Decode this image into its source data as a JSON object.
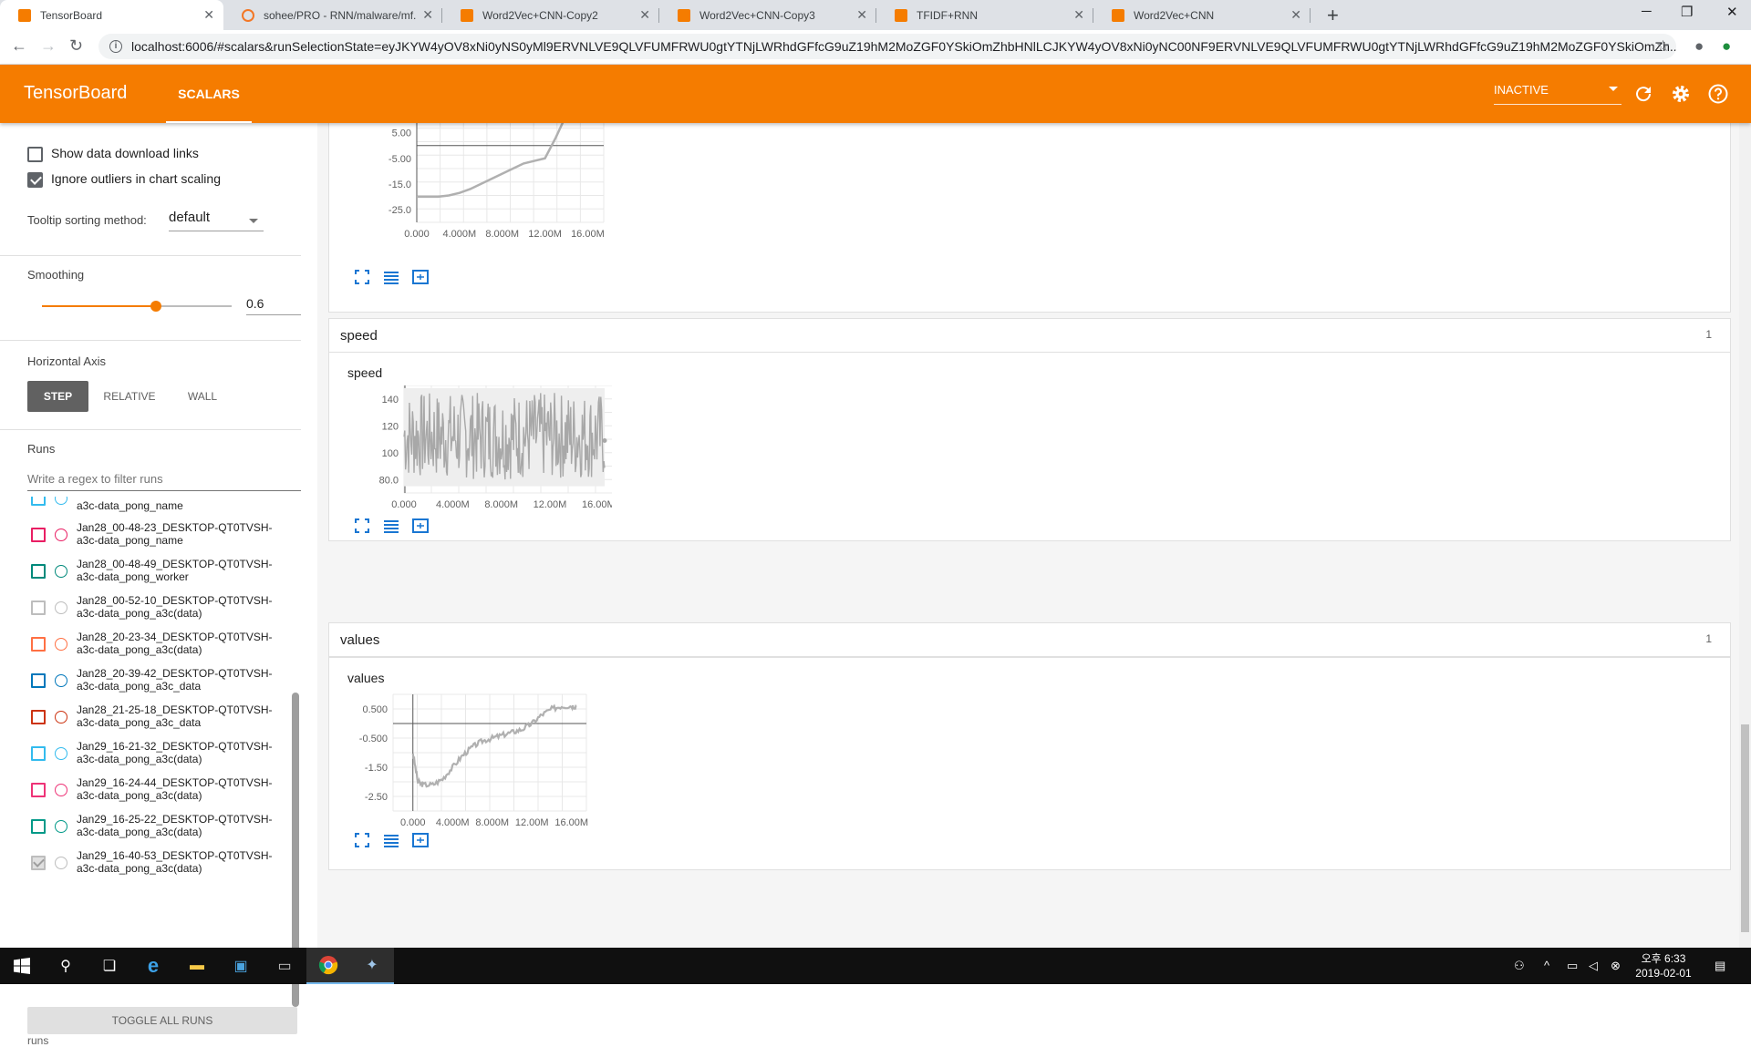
{
  "browser": {
    "tabs": [
      {
        "title": "TensorBoard",
        "favicon": "tensorboard-icon"
      },
      {
        "title": "sohee/PRO - RNN/malware/mf...",
        "favicon": "jupyter-icon"
      },
      {
        "title": "Word2Vec+CNN-Copy2",
        "favicon": "tensorboard-icon"
      },
      {
        "title": "Word2Vec+CNN-Copy3",
        "favicon": "tensorboard-icon"
      },
      {
        "title": "TFIDF+RNN",
        "favicon": "tensorboard-icon"
      },
      {
        "title": "Word2Vec+CNN",
        "favicon": "tensorboard-icon"
      }
    ],
    "url": "localhost:6006/#scalars&runSelectionState=eyJKYW4yOV8xNi0yNS0yMl9ERVNLVE9QLVFUMFRWU0gtYTNjLWRhdGFfcG9uZ19hM2MoZGF0YSkiOmZhbHNlLCJKYW4yOV8xNi0yNC00NF9ERVNLVE9QLVFUMFRWU0gtYTNjLWRhdGFfcG9uZ19hM2MoZGF0YSkiOmZh..."
  },
  "header": {
    "brand": "TensorBoard",
    "tab": "SCALARS",
    "mode": "INACTIVE",
    "colors": {
      "accent": "#f57c00"
    }
  },
  "sidebar": {
    "show_download_links": "Show data download links",
    "ignore_outliers": "Ignore outliers in chart scaling",
    "tooltip_label": "Tooltip sorting method:",
    "tooltip_value": "default",
    "smoothing_label": "Smoothing",
    "smoothing_value": "0.6",
    "smoothing": 0.6,
    "axis_label": "Horizontal Axis",
    "axis_options": [
      "STEP",
      "RELATIVE",
      "WALL"
    ],
    "runs_label": "Runs",
    "regex_placeholder": "Write a regex to filter runs",
    "partial_run": "a3c-data_pong_name",
    "runs": [
      {
        "line1": "Jan28_00-48-23_DESKTOP-QT0TVSH-",
        "line2": "a3c-data_pong_name",
        "color": "#e91e63",
        "checked": false,
        "enabled": true
      },
      {
        "line1": "Jan28_00-48-49_DESKTOP-QT0TVSH-",
        "line2": "a3c-data_pong_worker",
        "color": "#00897b",
        "checked": false,
        "enabled": true
      },
      {
        "line1": "Jan28_00-52-10_DESKTOP-QT0TVSH-",
        "line2": "a3c-data_pong_a3c(data)",
        "color": "#bdbdbd",
        "checked": false,
        "enabled": false
      },
      {
        "line1": "Jan28_20-23-34_DESKTOP-QT0TVSH-",
        "line2": "a3c-data_pong_a3c(data)",
        "color": "#ff7043",
        "checked": false,
        "enabled": true
      },
      {
        "line1": "Jan28_20-39-42_DESKTOP-QT0TVSH-",
        "line2": "a3c-data_pong_a3c_data",
        "color": "#0077bb",
        "checked": false,
        "enabled": true
      },
      {
        "line1": "Jan28_21-25-18_DESKTOP-QT0TVSH-",
        "line2": "a3c-data_pong_a3c_data",
        "color": "#cc3311",
        "checked": false,
        "enabled": true
      },
      {
        "line1": "Jan29_16-21-32_DESKTOP-QT0TVSH-",
        "line2": "a3c-data_pong_a3c(data)",
        "color": "#33bbee",
        "checked": false,
        "enabled": true
      },
      {
        "line1": "Jan29_16-24-44_DESKTOP-QT0TVSH-",
        "line2": "a3c-data_pong_a3c(data)",
        "color": "#ee3377",
        "checked": false,
        "enabled": true
      },
      {
        "line1": "Jan29_16-25-22_DESKTOP-QT0TVSH-",
        "line2": "a3c-data_pong_a3c(data)",
        "color": "#009988",
        "checked": false,
        "enabled": true
      },
      {
        "line1": "Jan29_16-40-53_DESKTOP-QT0TVSH-",
        "line2": "a3c-data_pong_a3c(data)",
        "color": "#bdbdbd",
        "checked": true,
        "enabled": false
      }
    ],
    "toggle_all": "TOGGLE ALL RUNS",
    "footer": "runs"
  },
  "main": {
    "categories": [
      {
        "name": "speed",
        "count": "1"
      },
      {
        "name": "values",
        "count": "1"
      }
    ]
  },
  "chart_data": [
    {
      "type": "line",
      "title": "",
      "ytick_labels": [
        "5.00",
        "-5.00",
        "-15.0",
        "-25.0"
      ],
      "xtick_labels": [
        "0.000",
        "4.000M",
        "8.000M",
        "12.00M",
        "16.00M"
      ],
      "ylim": [
        -30,
        12
      ],
      "xlim": [
        0,
        17500000
      ],
      "x": [
        0,
        1000000,
        2000000,
        3000000,
        4000000,
        5000000,
        6000000,
        7000000,
        8000000,
        9000000,
        10000000,
        11000000,
        12000000,
        13000000,
        14000000
      ],
      "series": [
        {
          "values": [
            -20,
            -20,
            -20,
            -19.5,
            -18.5,
            -17,
            -15,
            -13,
            -11,
            -9,
            -7,
            -6,
            -5,
            3,
            12
          ]
        }
      ]
    },
    {
      "type": "line",
      "title": "speed",
      "ytick_labels": [
        "140",
        "120",
        "100",
        "80.0"
      ],
      "xtick_labels": [
        "0.000",
        "4.000M",
        "8.000M",
        "12.00M",
        "16.00M"
      ],
      "ylim": [
        70,
        150
      ],
      "xlim": [
        0,
        18000000
      ],
      "band_min": 75,
      "band_max": 148,
      "last_x": 16500000,
      "last_value": 109
    },
    {
      "type": "line",
      "title": "values",
      "ytick_labels": [
        "0.500",
        "-0.500",
        "-1.50",
        "-2.50"
      ],
      "xtick_labels": [
        "0.000",
        "4.000M",
        "8.000M",
        "12.00M",
        "16.00M"
      ],
      "ylim": [
        -3,
        1
      ],
      "xlim": [
        -2000000,
        17500000
      ],
      "x": [
        0,
        500000,
        1000000,
        2000000,
        3000000,
        4000000,
        5000000,
        6000000,
        7000000,
        8000000,
        9000000,
        10000000,
        11000000,
        12000000,
        13000000,
        14000000,
        15000000,
        16000000,
        16500000
      ],
      "series": [
        {
          "values": [
            -1.0,
            -2.0,
            -2.1,
            -2.1,
            -1.9,
            -1.5,
            -1.1,
            -0.8,
            -0.6,
            -0.5,
            -0.4,
            -0.3,
            -0.2,
            0.0,
            0.3,
            0.5,
            0.6,
            0.6,
            0.6
          ]
        }
      ]
    }
  ],
  "taskbar": {
    "clock_time": "오후 6:33",
    "clock_date": "2019-02-01"
  }
}
